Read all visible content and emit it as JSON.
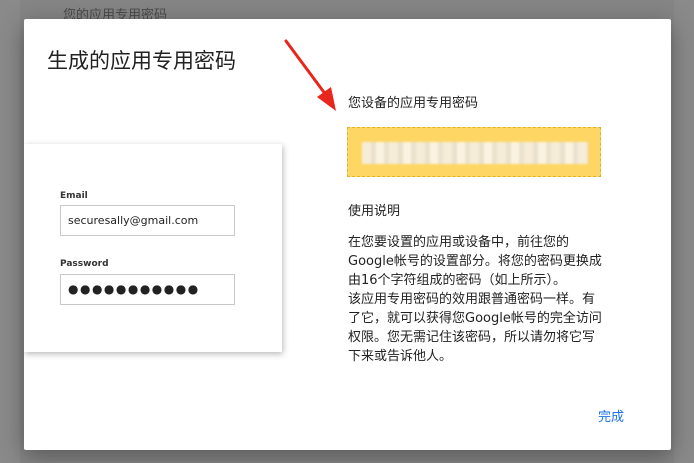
{
  "background": {
    "section_title": "您的应用专用密码"
  },
  "dialog": {
    "title": "生成的应用专用密码",
    "illustration": {
      "email_label": "Email",
      "email_value": "securesally@gmail.com",
      "password_label": "Password",
      "password_value": "●●●●●●●●●●●"
    },
    "password_heading": "您设备的应用专用密码",
    "usage_heading": "使用说明",
    "usage_lines": [
      "在您要设置的应用或设备中，前往您的",
      "Google帐号的设置部分。将您的密码更换成",
      "由16个字符组成的密码（如上所示）。",
      "该应用专用密码的效用跟普通密码一样。有",
      "了它，就可以获得您Google帐号的完全访问",
      "权限。您无需记住该密码，所以请勿将它写",
      "下来或告诉他人。"
    ],
    "done_label": "完成"
  },
  "colors": {
    "accent": "#1a73e8",
    "password_highlight": "#fdd663",
    "arrow": "#e8261c"
  },
  "icons": {
    "arrow": "red-annotation-arrow-icon"
  }
}
